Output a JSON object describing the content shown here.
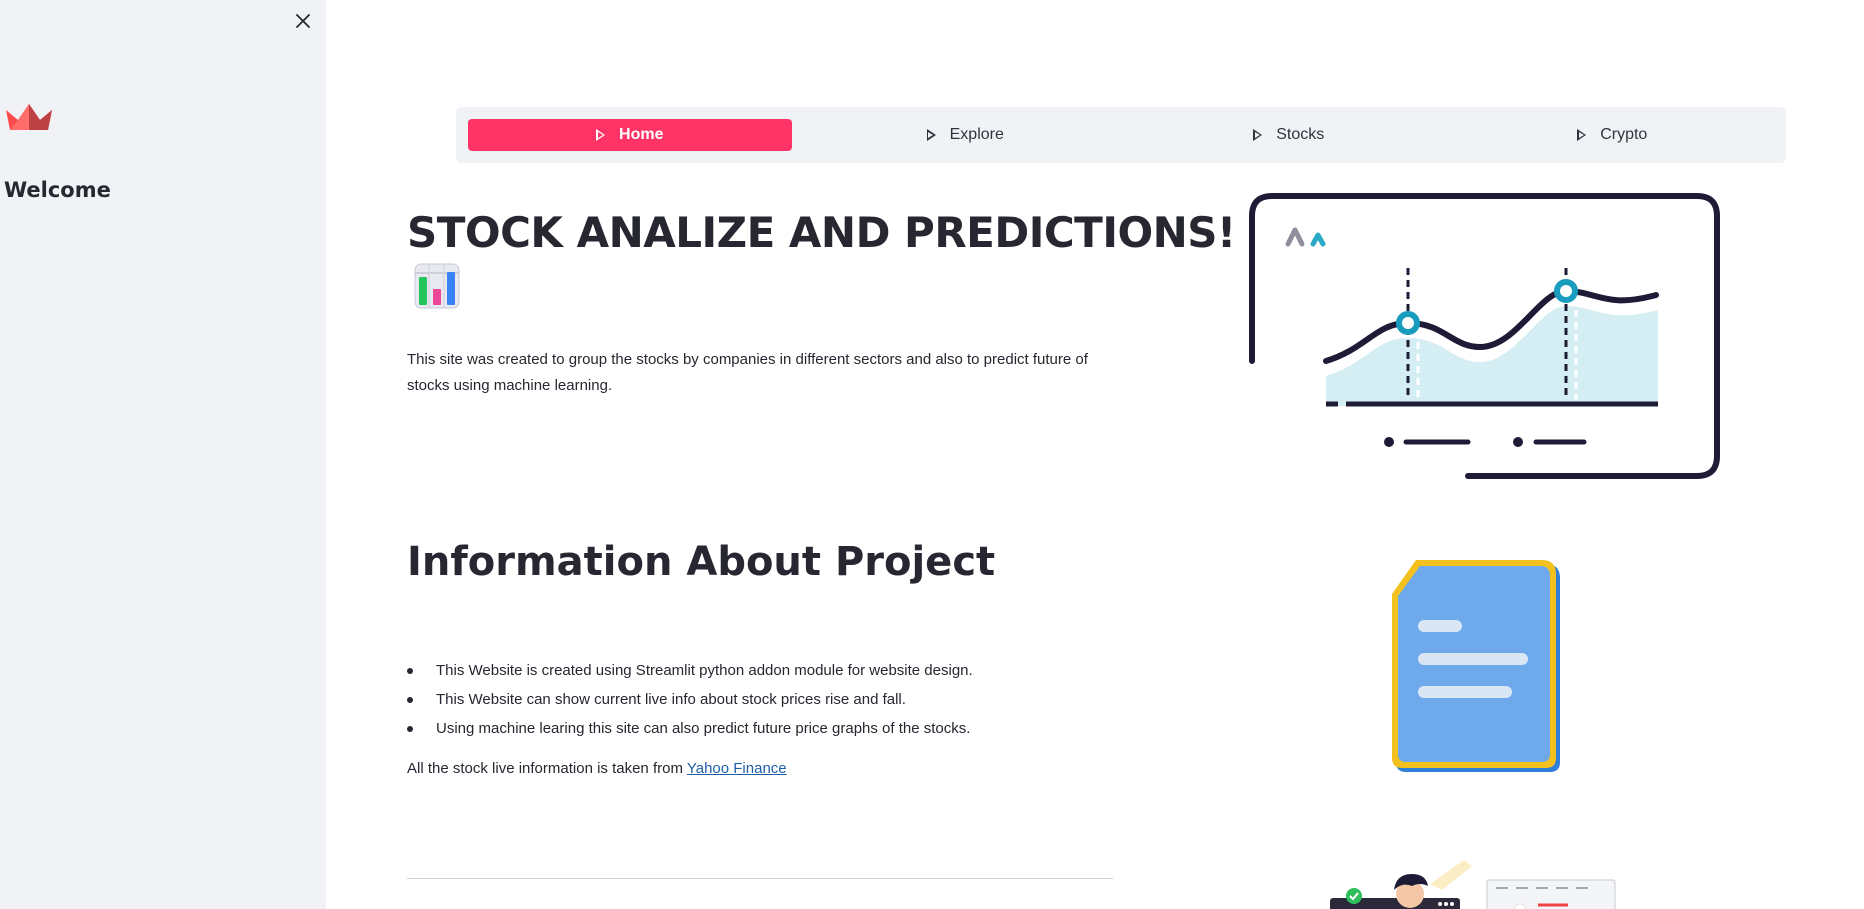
{
  "sidebar": {
    "close_icon": "close-icon",
    "logo_icon": "streamlit-crown-icon",
    "title": "Welcome"
  },
  "nav": {
    "items": [
      {
        "label": "Home",
        "active": true
      },
      {
        "label": "Explore",
        "active": false
      },
      {
        "label": "Stocks",
        "active": false
      },
      {
        "label": "Crypto",
        "active": false
      }
    ],
    "accent_color": "#ff3366"
  },
  "main": {
    "title": "STOCK ANALIZE AND PREDICTIONS!",
    "title_emoji": "bar-chart-emoji",
    "intro": "This site was created to group the stocks by companies in different sectors and also to predict future of stocks using machine learning.",
    "section_title": "Information About Project",
    "bullets": [
      "This Website is created using Streamlit python addon module for website design.",
      "This Website can show current live info about stock prices rise and fall.",
      "Using machine learing this site can also predict future price graphs of the stocks."
    ],
    "source_prefix": "All the stock live information is taken from ",
    "source_link": "Yahoo Finance"
  }
}
